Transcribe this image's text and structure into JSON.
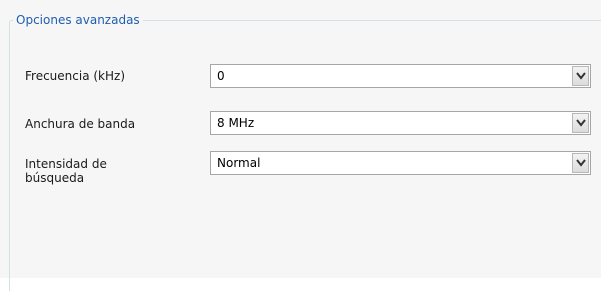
{
  "group": {
    "title": "Opciones avanzadas"
  },
  "fields": [
    {
      "label": "Frecuencia (kHz)",
      "value": "0"
    },
    {
      "label": "Anchura de banda",
      "value": "8 MHz"
    },
    {
      "label_line1": "Intensidad de",
      "label_line2": "búsqueda",
      "value": "Normal"
    }
  ],
  "icons": {
    "dropdown": "chevron-down-icon"
  }
}
